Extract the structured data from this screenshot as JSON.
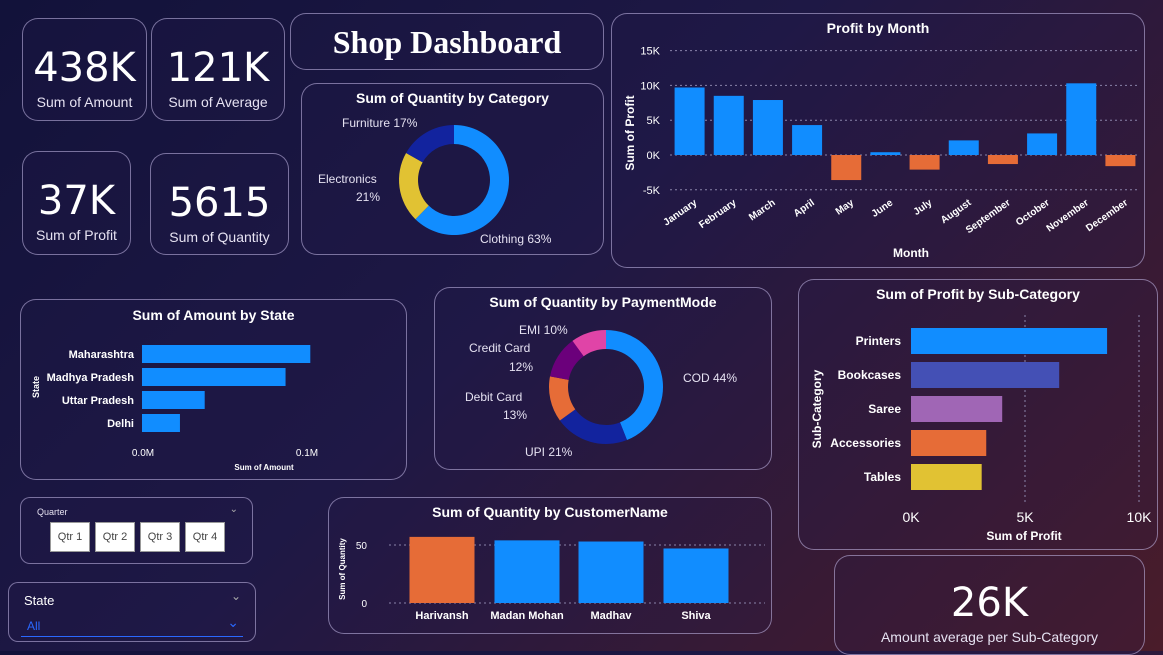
{
  "title": "Shop Dashboard",
  "kpis": {
    "amount": {
      "value": "438K",
      "label": "Sum of Amount"
    },
    "average": {
      "value": "121K",
      "label": "Sum of Average"
    },
    "profit": {
      "value": "37K",
      "label": "Sum of Profit"
    },
    "quantity": {
      "value": "5615",
      "label": "Sum of Quantity"
    },
    "avg_subcat": {
      "value": "26K",
      "label": "Amount average per Sub-Category"
    }
  },
  "colors": {
    "blue": "#118dff",
    "orange": "#e66c37",
    "yellow": "#e1c233",
    "navy": "#12239e",
    "purple": "#6b007b",
    "pink": "#e044a7",
    "indigo": "#4450b5",
    "lavender": "#a066b5"
  },
  "category_chart": {
    "title": "Sum of Quantity by Category",
    "labels": {
      "furniture": "Furniture 17%",
      "electronics_1": "Electronics",
      "electronics_2": "21%",
      "clothing": "Clothing 63%"
    }
  },
  "profit_month_chart": {
    "title": "Profit by Month",
    "xlabel": "Month",
    "ylabel": "Sum of Profit",
    "yticks": [
      "15K",
      "10K",
      "5K",
      "0K",
      "-5K"
    ]
  },
  "state_chart": {
    "title": "Sum of Amount by State",
    "xlabel": "Sum of Amount",
    "ylabel": "State",
    "xticks": [
      "0.0M",
      "0.1M"
    ]
  },
  "payment_chart": {
    "title": "Sum of Quantity by PaymentMode",
    "labels": {
      "emi": "EMI 10%",
      "credit_1": "Credit Card",
      "credit_2": "12%",
      "debit_1": "Debit Card",
      "debit_2": "13%",
      "upi": "UPI 21%",
      "cod": "COD 44%"
    }
  },
  "subcat_chart": {
    "title": "Sum of Profit by Sub-Category",
    "xlabel": "Sum of Profit",
    "ylabel": "Sub-Category",
    "xticks": [
      "0K",
      "5K",
      "10K"
    ]
  },
  "customer_chart": {
    "title": "Sum of Quantity by CustomerName",
    "ylabel": "Sum of Quantity",
    "yticks": [
      "50",
      "0"
    ]
  },
  "quarter_slicer": {
    "label": "Quarter",
    "options": [
      "Qtr 1",
      "Qtr 2",
      "Qtr 3",
      "Qtr 4"
    ]
  },
  "state_slicer": {
    "label": "State",
    "selected": "All"
  },
  "chart_data": [
    {
      "type": "pie",
      "title": "Sum of Quantity by Category",
      "categories": [
        "Clothing",
        "Electronics",
        "Furniture"
      ],
      "values": [
        63,
        21,
        17
      ],
      "colors": [
        "#118dff",
        "#e1c233",
        "#12239e"
      ]
    },
    {
      "type": "bar",
      "title": "Profit by Month",
      "categories": [
        "January",
        "February",
        "March",
        "April",
        "May",
        "June",
        "July",
        "August",
        "September",
        "October",
        "November",
        "December"
      ],
      "values": [
        9700,
        8500,
        7900,
        4300,
        -3600,
        400,
        -2100,
        2100,
        -1300,
        3100,
        10300,
        -1600
      ],
      "ylim": [
        -5000,
        15000
      ],
      "xlabel": "Month",
      "ylabel": "Sum of Profit",
      "grid": true
    },
    {
      "type": "bar",
      "orientation": "horizontal",
      "title": "Sum of Amount by State",
      "categories": [
        "Maharashtra",
        "Madhya Pradesh",
        "Uttar Pradesh",
        "Delhi"
      ],
      "values": [
        102000,
        87000,
        38000,
        23000
      ],
      "xlim": [
        0,
        110000
      ],
      "xlabel": "Sum of Amount",
      "ylabel": "State"
    },
    {
      "type": "pie",
      "title": "Sum of Quantity by PaymentMode",
      "categories": [
        "COD",
        "UPI",
        "Debit Card",
        "Credit Card",
        "EMI"
      ],
      "values": [
        44,
        21,
        13,
        12,
        10
      ],
      "colors": [
        "#118dff",
        "#12239e",
        "#e66c37",
        "#6b007b",
        "#e044a7"
      ]
    },
    {
      "type": "bar",
      "orientation": "horizontal",
      "title": "Sum of Profit by Sub-Category",
      "categories": [
        "Printers",
        "Bookcases",
        "Saree",
        "Accessories",
        "Tables"
      ],
      "values": [
        8600,
        6500,
        4000,
        3300,
        3100
      ],
      "xlim": [
        0,
        10000
      ],
      "xlabel": "Sum of Profit",
      "ylabel": "Sub-Category",
      "colors": [
        "#118dff",
        "#4450b5",
        "#a066b5",
        "#e66c37",
        "#e1c233"
      ]
    },
    {
      "type": "bar",
      "title": "Sum of Quantity by CustomerName",
      "categories": [
        "Harivansh",
        "Madan Mohan",
        "Madhav",
        "Shiva"
      ],
      "values": [
        57,
        54,
        53,
        47
      ],
      "ylim": [
        0,
        60
      ],
      "ylabel": "Sum of Quantity",
      "colors": [
        "#e66c37",
        "#118dff",
        "#118dff",
        "#118dff"
      ]
    }
  ]
}
